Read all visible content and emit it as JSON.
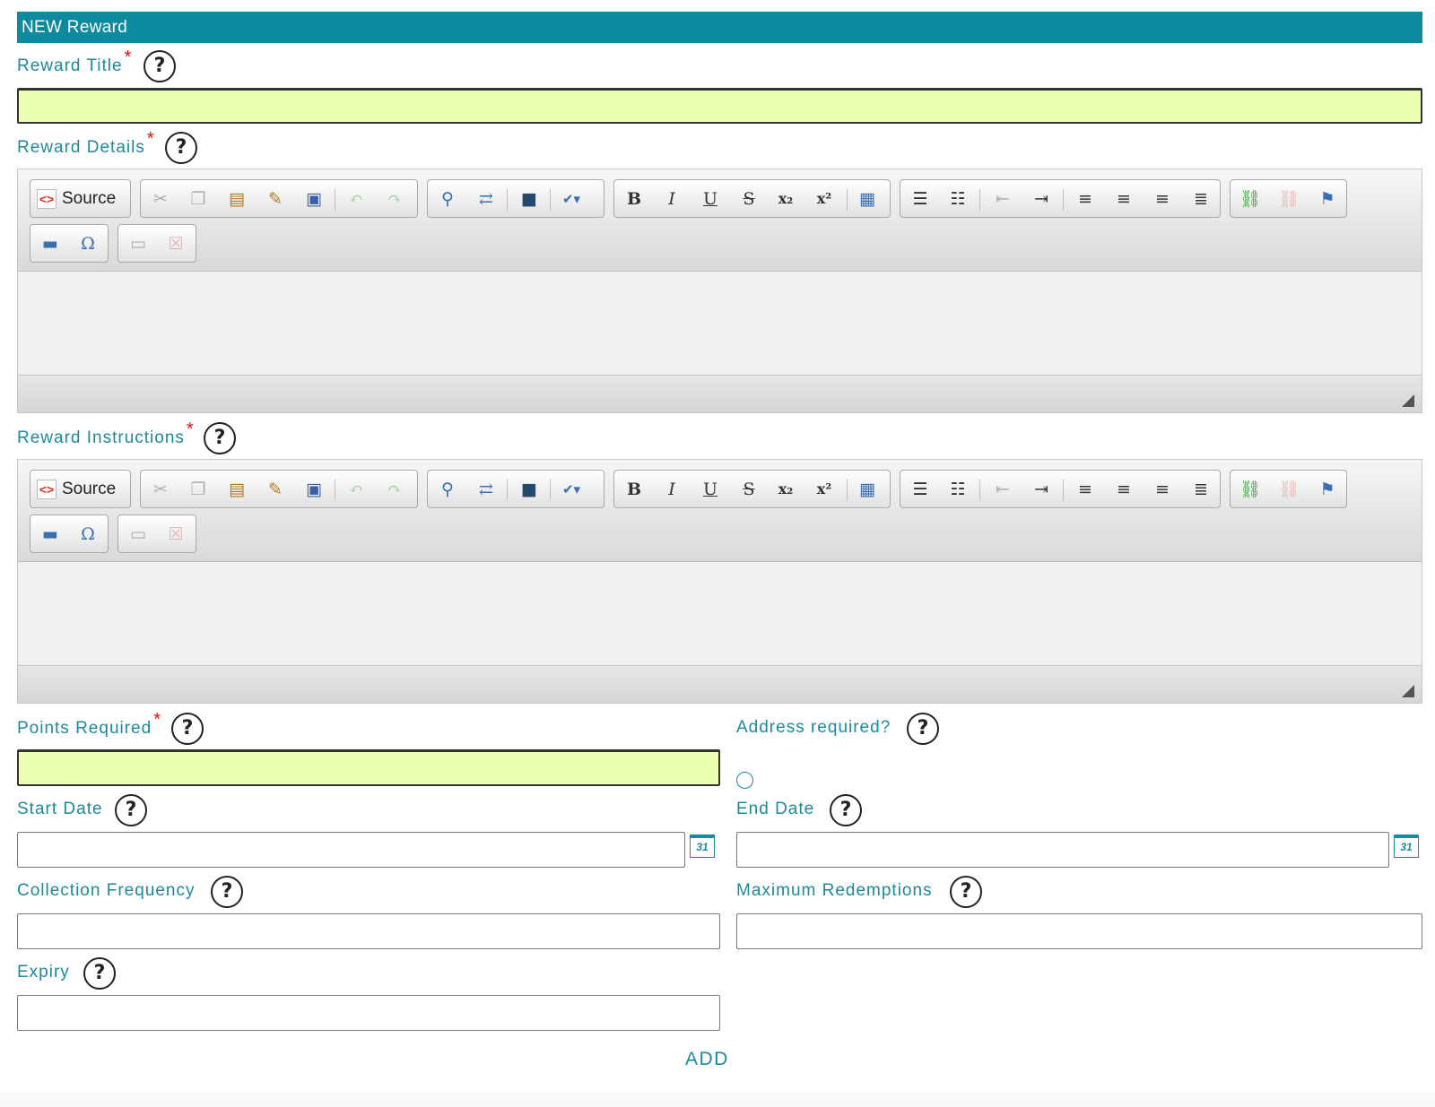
{
  "header": {
    "title": "NEW Reward"
  },
  "fields": {
    "reward_title": {
      "label": "Reward Title",
      "required": "*",
      "help": "?",
      "value": ""
    },
    "reward_details": {
      "label": "Reward Details",
      "required": "*",
      "help": "?"
    },
    "reward_instructions": {
      "label": "Reward Instructions",
      "required": "*",
      "help": "?"
    },
    "points_required": {
      "label": "Points Required",
      "required": "*",
      "help": "?",
      "value": ""
    },
    "address_required": {
      "label": "Address required?",
      "help": "?"
    },
    "start_date": {
      "label": "Start Date",
      "help": "?",
      "value": ""
    },
    "end_date": {
      "label": "End Date",
      "help": "?",
      "value": ""
    },
    "collection_frequency": {
      "label": "Collection Frequency",
      "help": "?",
      "value": ""
    },
    "maximum_redemptions": {
      "label": "Maximum Redemptions",
      "help": "?",
      "value": ""
    },
    "expiry": {
      "label": "Expiry",
      "help": "?",
      "value": ""
    }
  },
  "editor_toolbar": {
    "source_label": "Source",
    "source_icon": "<>",
    "bold": "B",
    "italic": "I",
    "underline": "U",
    "strike": "S",
    "subscript": "x₂",
    "superscript": "x²",
    "special_char": "Ω"
  },
  "calendar_icon_text": "31",
  "actions": {
    "add_label": "ADD"
  },
  "colors": {
    "accent": "#0d8a9e",
    "required_field_bg": "#ebffb3",
    "required_mark": "#e01010"
  }
}
